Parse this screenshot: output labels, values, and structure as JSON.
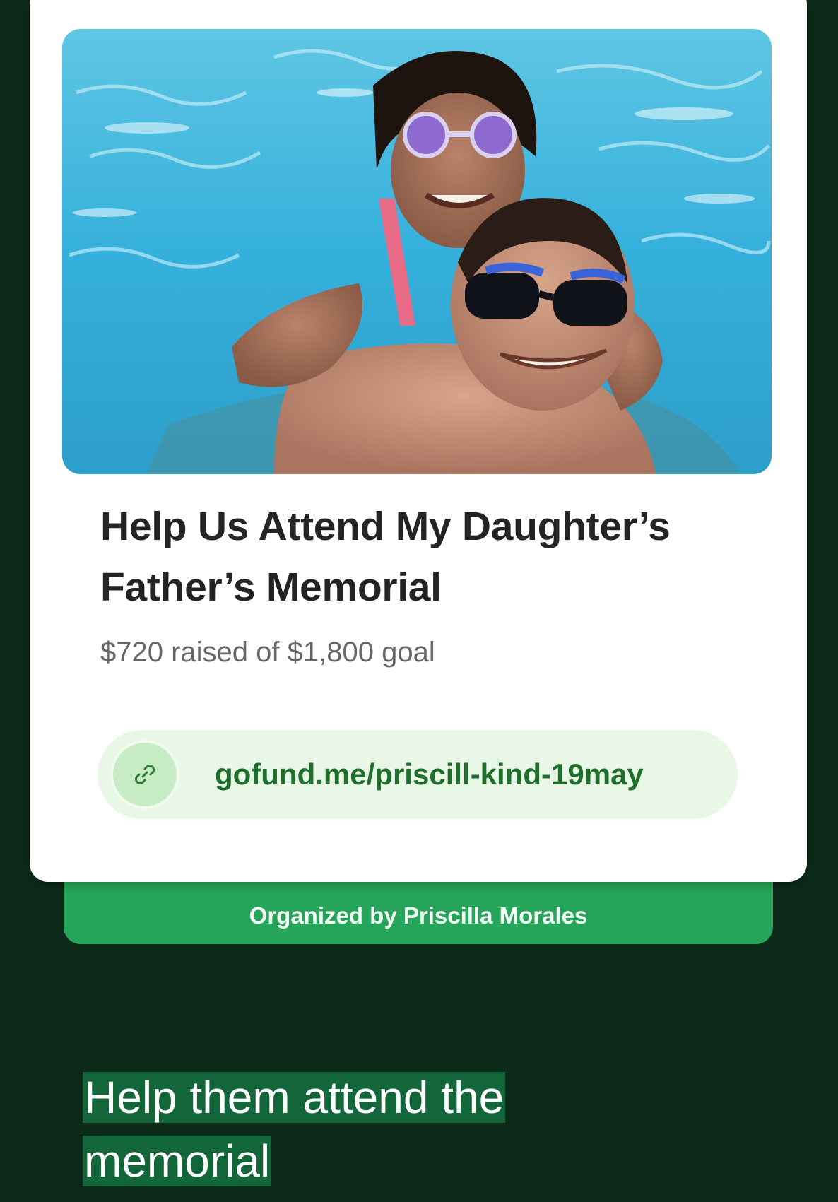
{
  "campaign": {
    "title": "Help Us Attend My Daughter’s Father’s Memorial",
    "raised_text": "$720 raised of $1,800 goal",
    "raised_amount": 720,
    "goal_amount": 1800,
    "link_icon": "link-icon",
    "link_url": "gofund.me/priscill-kind-19may",
    "organizer_text": "Organized by Priscilla Morales"
  },
  "caption": {
    "text": "Help them attend the memorial"
  },
  "colors": {
    "background": "#0b2a1a",
    "accent_green": "#26a45a",
    "link_text": "#1f6e2c",
    "link_pill": "#e9f7e6",
    "caption_highlight": "#13653a"
  }
}
